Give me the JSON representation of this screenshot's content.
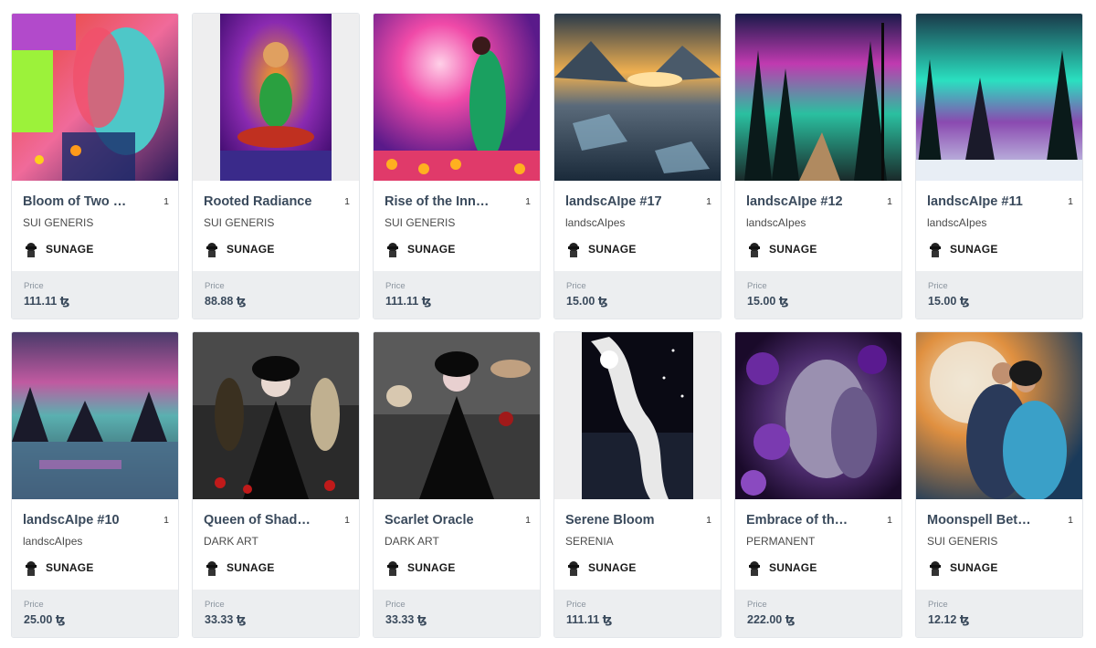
{
  "price_label": "Price",
  "cards": [
    {
      "title": "Bloom of Two …",
      "edition": "1",
      "collection": "SUI GENERIS",
      "creator": "SUNAGE",
      "price": "111.11 ꜩ"
    },
    {
      "title": "Rooted Radiance",
      "edition": "1",
      "collection": "SUI GENERIS",
      "creator": "SUNAGE",
      "price": "88.88 ꜩ"
    },
    {
      "title": "Rise of the Inn…",
      "edition": "1",
      "collection": "SUI GENERIS",
      "creator": "SUNAGE",
      "price": "111.11 ꜩ"
    },
    {
      "title": "landscAIpe #17",
      "edition": "1",
      "collection": "landscAIpes",
      "creator": "SUNAGE",
      "price": "15.00 ꜩ"
    },
    {
      "title": "landscAIpe #12",
      "edition": "1",
      "collection": "landscAIpes",
      "creator": "SUNAGE",
      "price": "15.00 ꜩ"
    },
    {
      "title": "landscAIpe #11",
      "edition": "1",
      "collection": "landscAIpes",
      "creator": "SUNAGE",
      "price": "15.00 ꜩ"
    },
    {
      "title": "landscAIpe #10",
      "edition": "1",
      "collection": "landscAIpes",
      "creator": "SUNAGE",
      "price": "25.00 ꜩ"
    },
    {
      "title": "Queen of Shad…",
      "edition": "1",
      "collection": "DARK ART",
      "creator": "SUNAGE",
      "price": "33.33 ꜩ"
    },
    {
      "title": "Scarlet Oracle",
      "edition": "1",
      "collection": "DARK ART",
      "creator": "SUNAGE",
      "price": "33.33 ꜩ"
    },
    {
      "title": "Serene Bloom",
      "edition": "1",
      "collection": "SERENIA",
      "creator": "SUNAGE",
      "price": "111.11 ꜩ"
    },
    {
      "title": "Embrace of th…",
      "edition": "1",
      "collection": "PERMANENT",
      "creator": "SUNAGE",
      "price": "222.00 ꜩ"
    },
    {
      "title": "Moonspell Bet…",
      "edition": "1",
      "collection": "SUI GENERIS",
      "creator": "SUNAGE",
      "price": "12.12 ꜩ"
    }
  ]
}
